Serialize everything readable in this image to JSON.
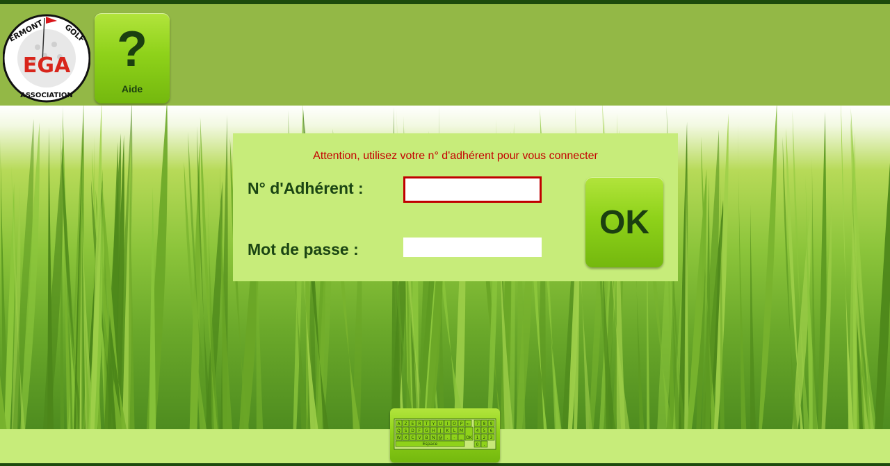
{
  "logo": {
    "top_text": "ERMONT",
    "side_text": "GOLF",
    "center_text": "EGA",
    "bottom_text": "ASSOCIATION"
  },
  "help": {
    "symbol": "?",
    "label": "Aide"
  },
  "login": {
    "notice": "Attention, utilisez votre n° d'adhérent pour vous connecter",
    "member_label": "N° d'Adhérent :",
    "member_value": "",
    "password_label": "Mot de passe :",
    "password_value": "",
    "ok_label": "OK"
  },
  "keyboard": {
    "rows": [
      [
        "A",
        "Z",
        "E",
        "R",
        "T",
        "Y",
        "U",
        "I",
        "O",
        "P",
        "←"
      ],
      [
        "Q",
        "S",
        "D",
        "F",
        "G",
        "H",
        "J",
        "K",
        "L",
        "M"
      ],
      [
        "W",
        "X",
        "C",
        "V",
        "B",
        "N",
        "@",
        ".",
        "-",
        "_"
      ]
    ],
    "digits": [
      [
        "7",
        "8",
        "9"
      ],
      [
        "4",
        "5",
        "6"
      ],
      [
        "1",
        "2",
        "3"
      ],
      [
        "0",
        "."
      ]
    ],
    "ok_key": "OK",
    "space_label": "Espace"
  },
  "colors": {
    "header_bg": "#93b846",
    "panel_bg": "#c7ec7a",
    "notice": "#c40000",
    "label_text": "#1b4513",
    "error_border": "#c00000"
  }
}
